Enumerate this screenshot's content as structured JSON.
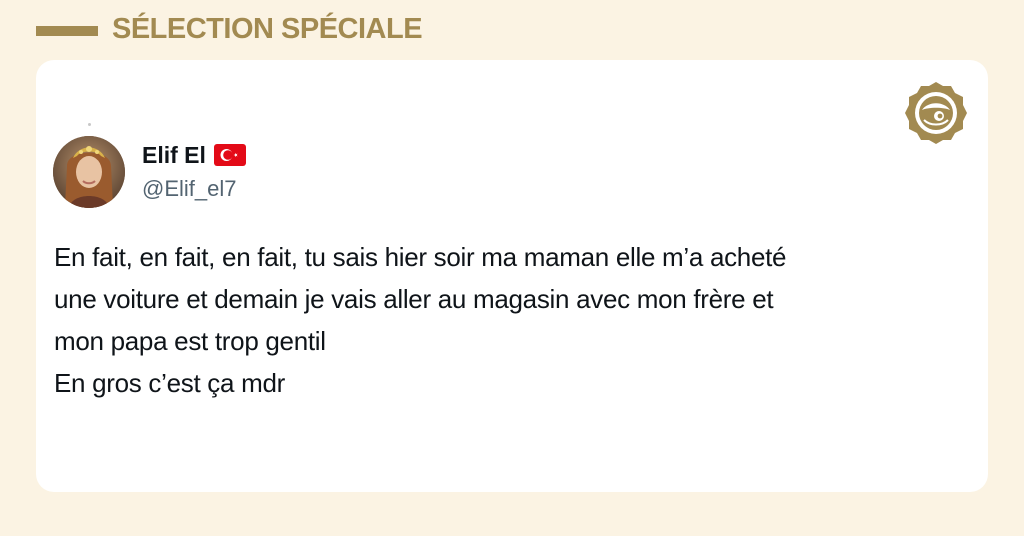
{
  "header": {
    "title": "SÉLECTION SPÉCIALE",
    "accent_color": "#a28a51",
    "background_color": "#fbf3e3"
  },
  "tweet": {
    "author_name": "Elif El",
    "author_flag": "turkey-flag-icon",
    "handle": "@Elif_el7",
    "text_lines": [
      "En fait, en fait, en fait, tu sais hier soir ma maman elle m’a acheté",
      "une voiture et demain je vais aller au magasin avec mon frère et",
      "mon papa est trop gentil",
      "En gros c’est ça mdr"
    ]
  },
  "brand": {
    "logo_icon": "brand-seal-logo-icon"
  }
}
